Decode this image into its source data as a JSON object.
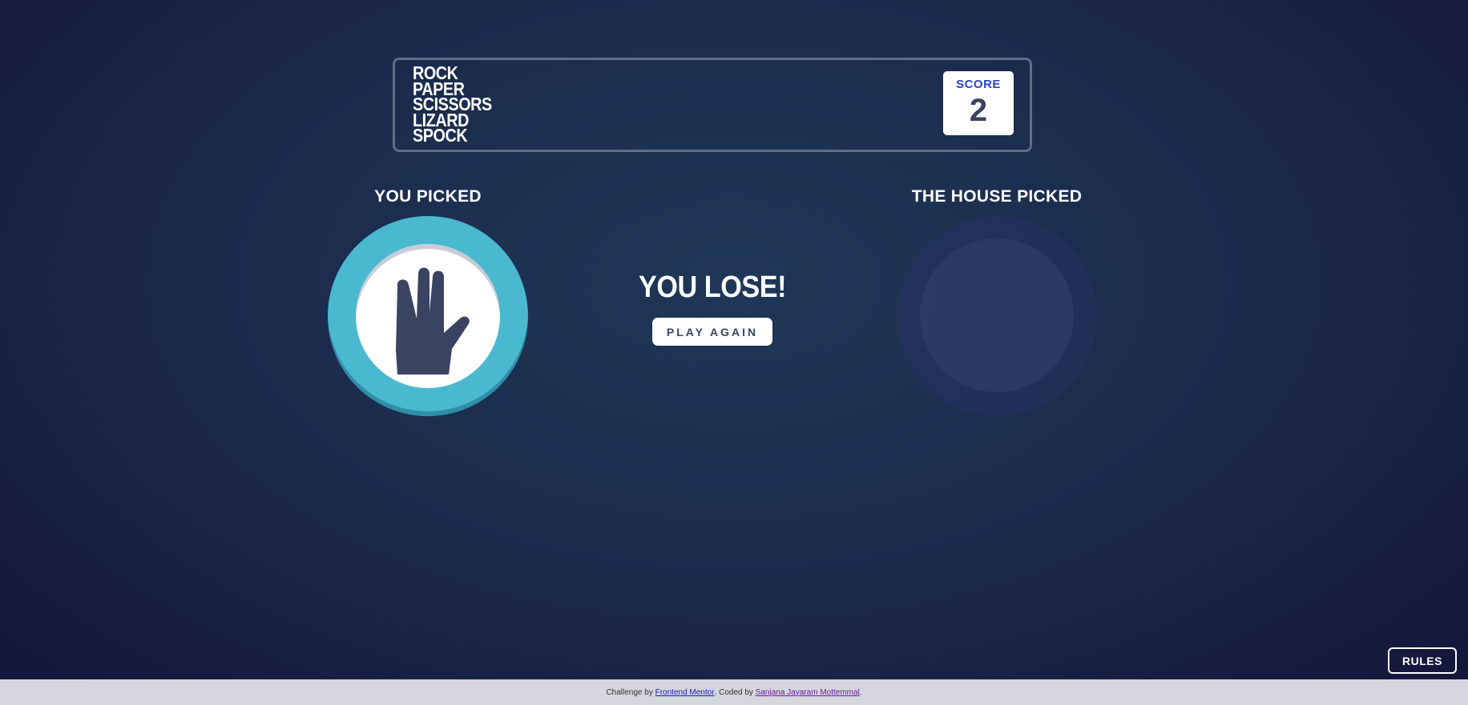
{
  "header": {
    "logo_lines": [
      "ROCK",
      "PAPER",
      "SCISSORS",
      "LIZARD",
      "SPOCK"
    ],
    "score_label": "SCORE",
    "score_value": "2"
  },
  "game": {
    "you_picked_label": "YOU PICKED",
    "house_picked_label": "THE HOUSE PICKED",
    "player_choice": "spock",
    "house_choice": "",
    "result_text": "YOU LOSE!",
    "play_again_label": "PLAY AGAIN"
  },
  "rules_label": "RULES",
  "footer": {
    "prefix": "Challenge by ",
    "link1": "Frontend Mentor",
    "middle": ". Coded by ",
    "link2": "Sanjana Jayaram Mottemmal",
    "suffix": "."
  },
  "colors": {
    "spock_ring": "#4ab9d0",
    "score_label": "#2a45c2",
    "dark_text": "#3b4363"
  },
  "icons": {
    "player_token": "spock-hand-icon"
  }
}
